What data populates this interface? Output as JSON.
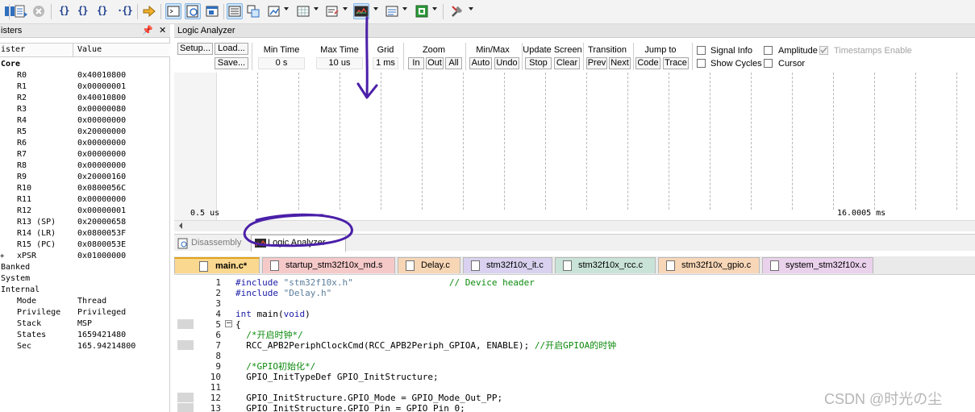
{
  "toolbar": {
    "colors": {
      "accent": "#2f6fbf",
      "active": "#cfe6fb"
    }
  },
  "registers": {
    "panel_title": "isters",
    "col_register": "ister",
    "col_value": "Value",
    "pin": "᪭",
    "close": "✕",
    "rows": [
      {
        "indent": 0,
        "expand": "",
        "name": "Core",
        "value": "",
        "bold": true
      },
      {
        "indent": 2,
        "expand": "",
        "name": "R0",
        "value": "0x40010800"
      },
      {
        "indent": 2,
        "expand": "",
        "name": "R1",
        "value": "0x00000001"
      },
      {
        "indent": 2,
        "expand": "",
        "name": "R2",
        "value": "0x40010800"
      },
      {
        "indent": 2,
        "expand": "",
        "name": "R3",
        "value": "0x00000080"
      },
      {
        "indent": 2,
        "expand": "",
        "name": "R4",
        "value": "0x00000000"
      },
      {
        "indent": 2,
        "expand": "",
        "name": "R5",
        "value": "0x20000000"
      },
      {
        "indent": 2,
        "expand": "",
        "name": "R6",
        "value": "0x00000000"
      },
      {
        "indent": 2,
        "expand": "",
        "name": "R7",
        "value": "0x00000000"
      },
      {
        "indent": 2,
        "expand": "",
        "name": "R8",
        "value": "0x00000000"
      },
      {
        "indent": 2,
        "expand": "",
        "name": "R9",
        "value": "0x20000160"
      },
      {
        "indent": 2,
        "expand": "",
        "name": "R10",
        "value": "0x0800056C"
      },
      {
        "indent": 2,
        "expand": "",
        "name": "R11",
        "value": "0x00000000"
      },
      {
        "indent": 2,
        "expand": "",
        "name": "R12",
        "value": "0x00000001"
      },
      {
        "indent": 2,
        "expand": "",
        "name": "R13 (SP)",
        "value": "0x20000658"
      },
      {
        "indent": 2,
        "expand": "",
        "name": "R14 (LR)",
        "value": "0x0800053F"
      },
      {
        "indent": 2,
        "expand": "",
        "name": "R15 (PC)",
        "value": "0x0800053E"
      },
      {
        "indent": 2,
        "expand": "+",
        "name": "xPSR",
        "value": "0x01000000"
      },
      {
        "indent": 0,
        "expand": "",
        "name": "Banked",
        "value": ""
      },
      {
        "indent": 0,
        "expand": "",
        "name": "System",
        "value": ""
      },
      {
        "indent": 0,
        "expand": "",
        "name": "Internal",
        "value": ""
      },
      {
        "indent": 2,
        "expand": "",
        "name": "Mode",
        "value": "Thread"
      },
      {
        "indent": 2,
        "expand": "",
        "name": "Privilege",
        "value": "Privileged"
      },
      {
        "indent": 2,
        "expand": "",
        "name": "Stack",
        "value": "MSP"
      },
      {
        "indent": 2,
        "expand": "",
        "name": "States",
        "value": "1659421480"
      },
      {
        "indent": 2,
        "expand": "",
        "name": "Sec",
        "value": "165.94214800"
      }
    ]
  },
  "logic_analyzer": {
    "title": "Logic Analyzer",
    "setup": "Setup...",
    "load": "Load...",
    "save": "Save...",
    "min_time_label": "Min Time",
    "min_time": "0 s",
    "max_time_label": "Max Time",
    "max_time": "10 us",
    "grid_label": "Grid",
    "grid": "1 ms",
    "zoom_label": "Zoom",
    "zoom_in": "In",
    "zoom_out": "Out",
    "zoom_all": "All",
    "minmax_label": "Min/Max",
    "auto": "Auto",
    "undo": "Undo",
    "update_label": "Update Screen",
    "stop": "Stop",
    "clear": "Clear",
    "transition_label": "Transition",
    "prev": "Prev",
    "next": "Next",
    "jump_label": "Jump to",
    "code": "Code",
    "trace": "Trace",
    "signal_info": "Signal Info",
    "show_cycles": "Show Cycles",
    "amplitude": "Amplitude",
    "cursor": "Cursor",
    "timestamps": "Timestamps Enable",
    "time_left": "0.5 us",
    "time_right": "16.0005 ms"
  },
  "view_tabs": {
    "disassembly": "Disassembly",
    "logic_analyzer": "Logic Analyzer"
  },
  "file_tabs": [
    {
      "label": "main.c*",
      "color": "#fbd88f",
      "active": true
    },
    {
      "label": "startup_stm32f10x_md.s",
      "color": "#f6c9c9"
    },
    {
      "label": "Delay.c",
      "color": "#f7d6b5"
    },
    {
      "label": "stm32f10x_it.c",
      "color": "#d9d1ef"
    },
    {
      "label": "stm32f10x_rcc.c",
      "color": "#c9e3d9"
    },
    {
      "label": "stm32f10x_gpio.c",
      "color": "#f8d7b8"
    },
    {
      "label": "system_stm32f10x.c",
      "color": "#ead1ec"
    }
  ],
  "code": [
    {
      "n": "1",
      "segs": [
        [
          "pp",
          "#include "
        ],
        [
          "str",
          "\"stm32f10x.h\""
        ],
        [
          "",
          "                  "
        ],
        [
          "cmt",
          "// Device header"
        ]
      ]
    },
    {
      "n": "2",
      "segs": [
        [
          "pp",
          "#include "
        ],
        [
          "str",
          "\"Delay.h\""
        ]
      ]
    },
    {
      "n": "3",
      "segs": []
    },
    {
      "n": "4",
      "segs": [
        [
          "kw",
          "int"
        ],
        [
          "",
          " main("
        ],
        [
          "kw",
          "void"
        ],
        [
          "",
          ")"
        ]
      ]
    },
    {
      "n": "5",
      "segs": [
        [
          "",
          "{"
        ]
      ],
      "fold": true,
      "bp": true
    },
    {
      "n": "6",
      "segs": [
        [
          "",
          "  "
        ],
        [
          "cmt",
          "/*开启时钟*/"
        ]
      ]
    },
    {
      "n": "7",
      "segs": [
        [
          "",
          "  RCC_APB2PeriphClockCmd(RCC_APB2Periph_GPIOA, ENABLE); "
        ],
        [
          "cmt",
          "//开启GPIOA的时钟"
        ]
      ],
      "bp": true
    },
    {
      "n": "8",
      "segs": []
    },
    {
      "n": "9",
      "segs": [
        [
          "",
          "  "
        ],
        [
          "cmt",
          "/*GPIO初始化*/"
        ]
      ]
    },
    {
      "n": "10",
      "segs": [
        [
          "",
          "  GPIO_InitTypeDef GPIO_InitStructure;"
        ]
      ]
    },
    {
      "n": "11",
      "segs": []
    },
    {
      "n": "12",
      "segs": [
        [
          "",
          "  GPIO_InitStructure.GPIO_Mode = GPIO_Mode_Out_PP;"
        ]
      ],
      "bp": true
    },
    {
      "n": "13",
      "segs": [
        [
          "",
          "  GPIO_InitStructure.GPIO_Pin = GPIO_Pin_0;"
        ]
      ],
      "bp": true
    }
  ],
  "watermark": "CSDN @时光の尘"
}
